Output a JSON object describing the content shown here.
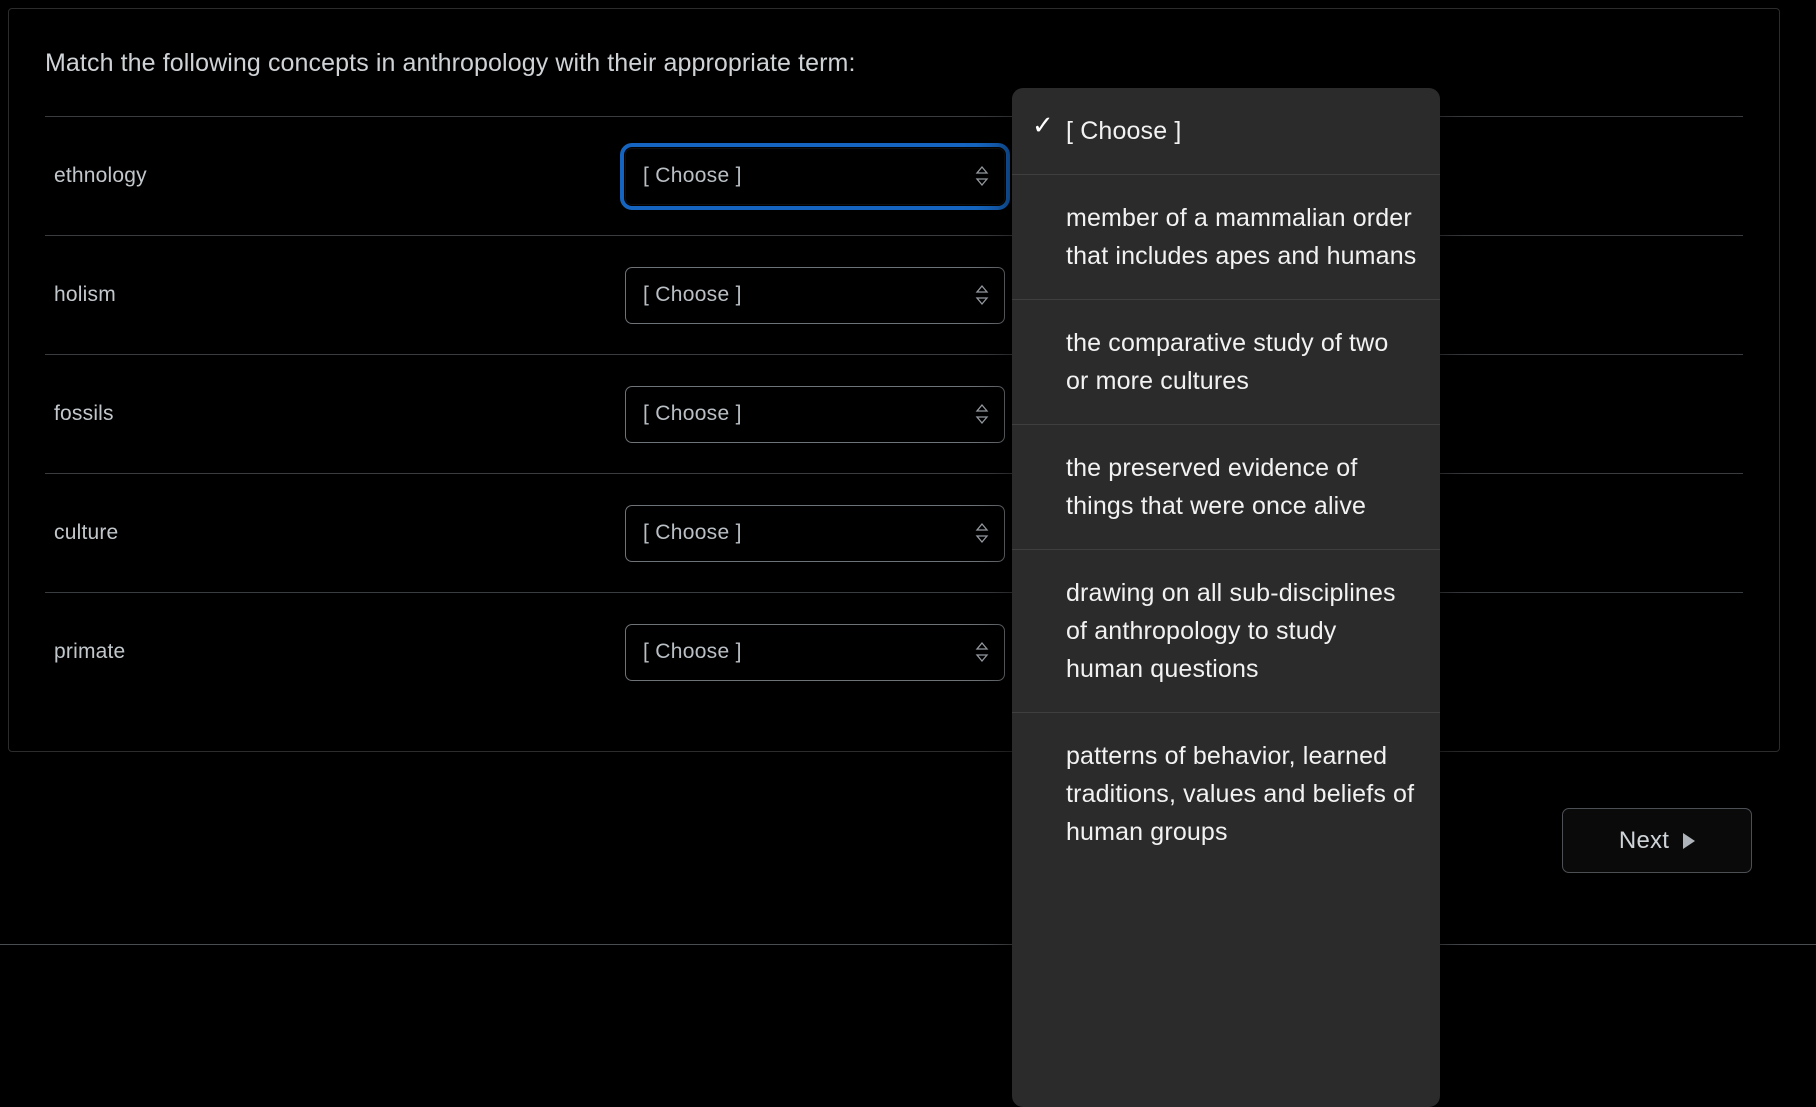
{
  "question": {
    "prompt": "Match the following concepts in anthropology with their appropriate term:",
    "rows": [
      {
        "term": "ethnology",
        "select_value": "[ Choose ]",
        "focused": true
      },
      {
        "term": "holism",
        "select_value": "[ Choose ]",
        "focused": false
      },
      {
        "term": "fossils",
        "select_value": "[ Choose ]",
        "focused": false
      },
      {
        "term": "culture",
        "select_value": "[ Choose ]",
        "focused": false
      },
      {
        "term": "primate",
        "select_value": "[ Choose ]",
        "focused": false
      }
    ]
  },
  "dropdown": {
    "open": true,
    "selected_index": 0,
    "check_glyph": "✓",
    "options": [
      {
        "label": "[ Choose ]",
        "selected": true
      },
      {
        "label": "member of a mammalian order that includes apes and humans",
        "selected": false
      },
      {
        "label": "the comparative study of two or more cultures",
        "selected": false
      },
      {
        "label": "the preserved evidence of things that were once alive",
        "selected": false
      },
      {
        "label": "drawing on all sub-disciplines of anthropology to study human questions",
        "selected": false
      },
      {
        "label": "patterns of behavior, learned traditions, values and beliefs of human groups",
        "selected": false
      }
    ]
  },
  "footer": {
    "next_label": "Next"
  },
  "colors": {
    "background": "#000000",
    "focus_ring": "#1565c0",
    "dropdown_background": "#2b2b2b",
    "text_primary": "#f2f2f2",
    "text_muted": "#b9bfc4",
    "border": "#6e7377"
  },
  "icons": {
    "select_chevron": "chevron-up-down-icon",
    "next_caret": "caret-right-icon",
    "check": "check-icon"
  }
}
